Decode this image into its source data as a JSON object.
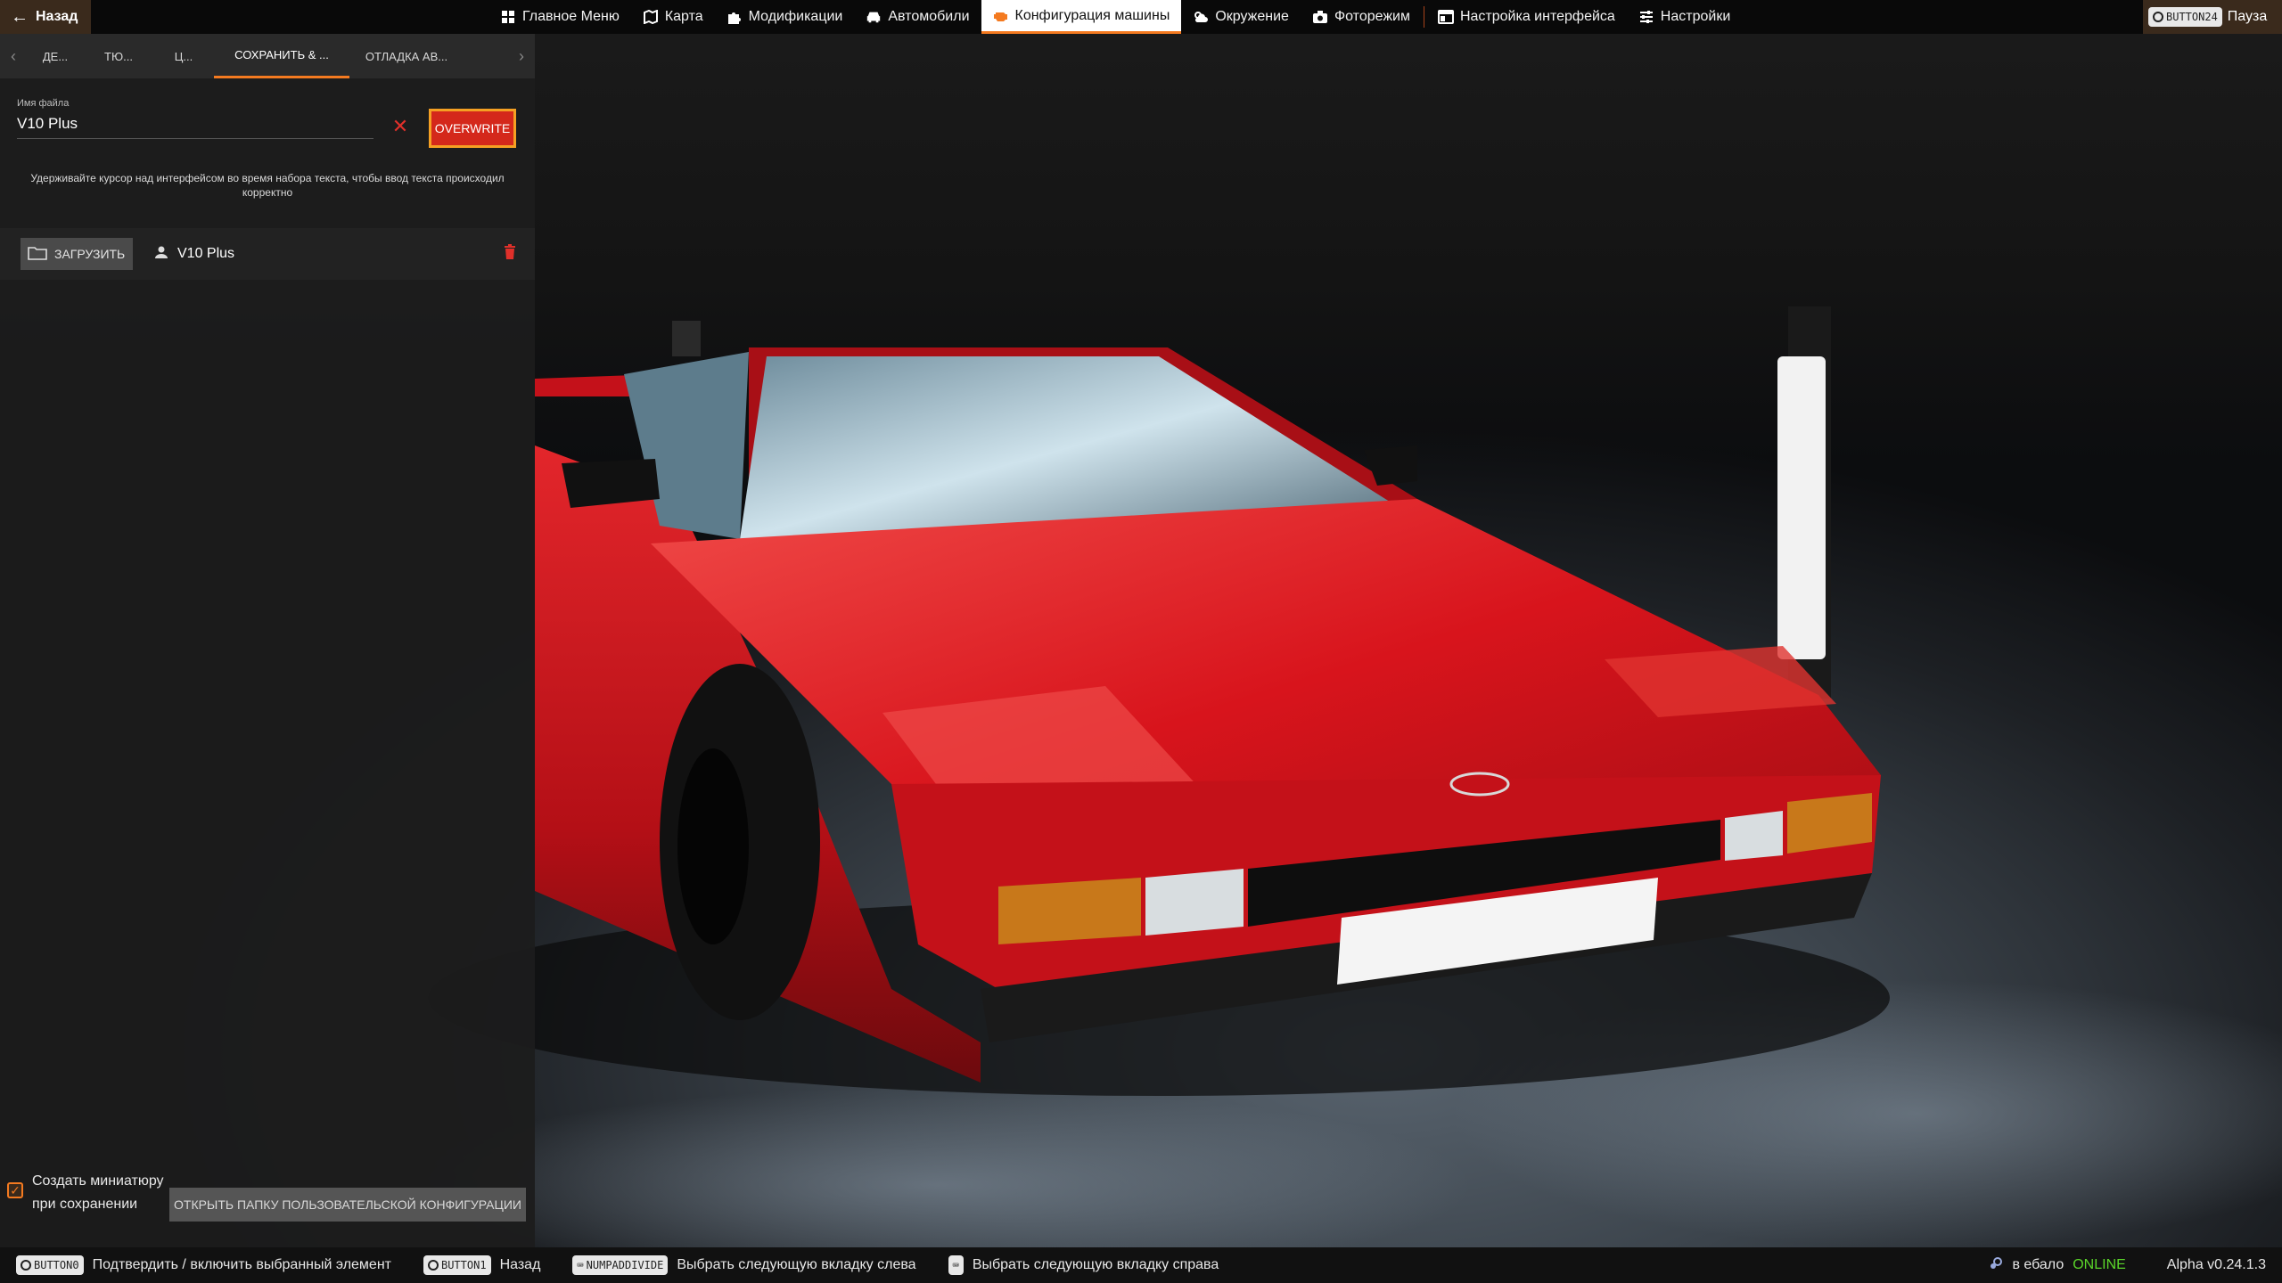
{
  "topbar": {
    "back_label": "Назад",
    "tabs": [
      {
        "label": "Главное Меню",
        "icon": "home-icon"
      },
      {
        "label": "Карта",
        "icon": "map-icon"
      },
      {
        "label": "Модификации",
        "icon": "puzzle-icon"
      },
      {
        "label": "Автомобили",
        "icon": "car-icon"
      },
      {
        "label": "Конфигурация машины",
        "icon": "engine-icon",
        "active": true
      },
      {
        "label": "Окружение",
        "icon": "weather-icon"
      },
      {
        "label": "Фоторежим",
        "icon": "camera-icon"
      },
      {
        "label": "Настройка интерфейса",
        "icon": "layout-icon"
      },
      {
        "label": "Настройки",
        "icon": "sliders-icon"
      }
    ],
    "pause_key": "BUTTON24",
    "pause_label": "Пауза"
  },
  "panel": {
    "subtabs": [
      "ДЕ...",
      "ТЮ...",
      "Ц...",
      "СОХРАНИТЬ & ...",
      "ОТЛАДКА АВ..."
    ],
    "active_subtab": 3,
    "file_label": "Имя файла",
    "file_value": "V10 Plus",
    "overwrite_label": "OVERWRITE",
    "hint": "Удерживайте курсор над интерфейсом во время набора текста, чтобы ввод текста происходил корректно",
    "load_label": "ЗАГРУЗИТЬ",
    "config_name": "V10 Plus",
    "thumbnail_label": "Создать миниатюру при сохранении",
    "thumbnail_checked": true,
    "open_folder_label": "ОТКРЫТЬ ПАПКУ ПОЛЬЗОВАТЕЛЬСКОЙ КОНФИГУРАЦИИ"
  },
  "bottombar": {
    "hints": [
      {
        "key": "BUTTON0",
        "label": "Подтвердить / включить выбранный элемент"
      },
      {
        "key": "BUTTON1",
        "label": "Назад"
      },
      {
        "key": "NUMPADDIVIDE",
        "label": "Выбрать следующую вкладку слева"
      },
      {
        "key": "",
        "label": "Выбрать следующую вкладку справа"
      }
    ],
    "user": "в ебало",
    "status": "ONLINE",
    "version": "Alpha v0.24.1.3"
  },
  "colors": {
    "accent": "#f47a20",
    "danger": "#d4281b",
    "online": "#5bd62a",
    "car_red": "#d8141c"
  }
}
